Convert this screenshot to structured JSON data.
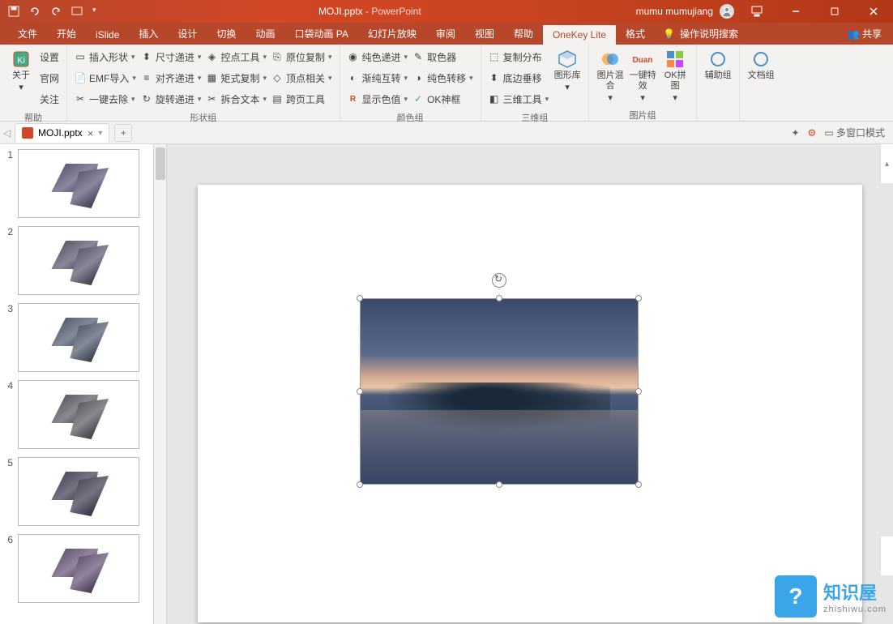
{
  "titlebar": {
    "filename": "MOJI.pptx",
    "appname": "PowerPoint",
    "username": "mumu mumujiang"
  },
  "tabs": {
    "file": "文件",
    "home": "开始",
    "islide": "iSlide",
    "insert": "插入",
    "design": "设计",
    "transitions": "切换",
    "animations": "动画",
    "pocket": "口袋动画 PA",
    "slideshow": "幻灯片放映",
    "review": "审阅",
    "view": "视图",
    "help": "帮助",
    "onekey": "OneKey Lite",
    "format": "格式",
    "tellme": "操作说明搜索",
    "share": "共享"
  },
  "ribbon": {
    "help_group": {
      "settings": "设置",
      "official": "官网",
      "follow": "关注",
      "about": "关于",
      "label": "帮助"
    },
    "shape_group": {
      "insert_shape": "插入形状",
      "emf_import": "EMF导入",
      "one_remove": "一键去除",
      "size_step": "尺寸递进",
      "align_step": "对齐递进",
      "rotate_step": "旋转递进",
      "control_tools": "控点工具",
      "matrix_copy": "矩式复制",
      "split_text": "拆合文本",
      "origin_copy": "原位复制",
      "vertex_related": "顶点相关",
      "cross_tools": "跨页工具",
      "label": "形状组"
    },
    "color_group": {
      "pure_step": "纯色递进",
      "gradient_swap": "渐纯互转",
      "show_value": "显示色值",
      "eyedropper": "取色器",
      "pure_swap": "纯色转移",
      "ok_frame": "OK神框",
      "label": "颜色组"
    },
    "threed_group": {
      "copy_dist": "复制分布",
      "bottom_shift": "底边垂移",
      "threed_tools": "三维工具",
      "shape_lib": "图形库",
      "label": "三维组"
    },
    "image_group": {
      "pic_blend": "图片混合",
      "one_effect": "一键特效",
      "ok_pin": "OK拼图",
      "label": "图片组"
    },
    "aux_group": "辅助组",
    "doc_group": "文档组"
  },
  "doctab": {
    "name": "MOJI.pptx",
    "multiwindow": "多窗口模式"
  },
  "slides": {
    "count": 6,
    "numbers": [
      "1",
      "2",
      "3",
      "4",
      "5",
      "6"
    ]
  },
  "watermark": {
    "title": "知识屋",
    "url": "zhishiwu.com"
  }
}
